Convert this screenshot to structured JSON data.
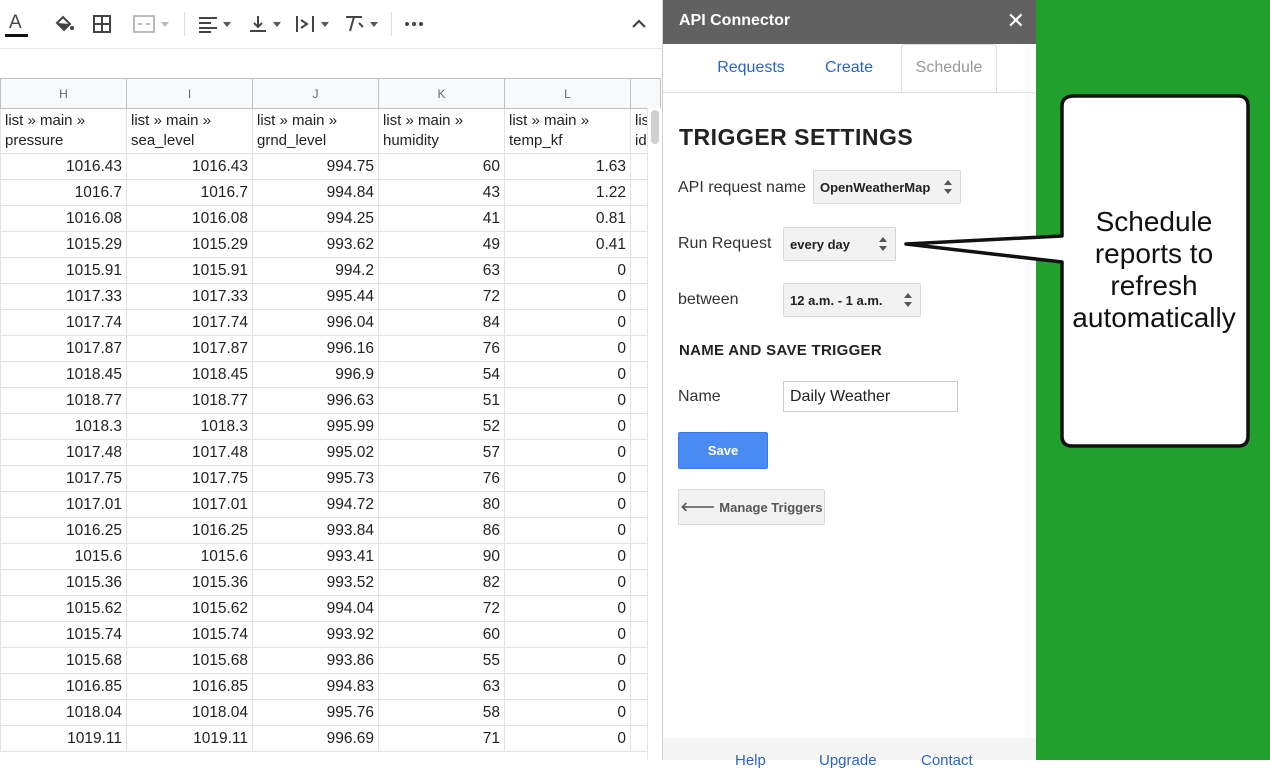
{
  "sheet": {
    "columns": [
      "H",
      "I",
      "J",
      "K",
      "L"
    ],
    "header_row": [
      "list » main » pressure",
      "list » main » sea_level",
      "list » main » grnd_level",
      "list » main » humidity",
      "list » main » temp_kf"
    ],
    "partial_col_header": "lis id",
    "rows": [
      [
        "1016.43",
        "1016.43",
        "994.75",
        "60",
        "1.63"
      ],
      [
        "1016.7",
        "1016.7",
        "994.84",
        "43",
        "1.22"
      ],
      [
        "1016.08",
        "1016.08",
        "994.25",
        "41",
        "0.81"
      ],
      [
        "1015.29",
        "1015.29",
        "993.62",
        "49",
        "0.41"
      ],
      [
        "1015.91",
        "1015.91",
        "994.2",
        "63",
        "0"
      ],
      [
        "1017.33",
        "1017.33",
        "995.44",
        "72",
        "0"
      ],
      [
        "1017.74",
        "1017.74",
        "996.04",
        "84",
        "0"
      ],
      [
        "1017.87",
        "1017.87",
        "996.16",
        "76",
        "0"
      ],
      [
        "1018.45",
        "1018.45",
        "996.9",
        "54",
        "0"
      ],
      [
        "1018.77",
        "1018.77",
        "996.63",
        "51",
        "0"
      ],
      [
        "1018.3",
        "1018.3",
        "995.99",
        "52",
        "0"
      ],
      [
        "1017.48",
        "1017.48",
        "995.02",
        "57",
        "0"
      ],
      [
        "1017.75",
        "1017.75",
        "995.73",
        "76",
        "0"
      ],
      [
        "1017.01",
        "1017.01",
        "994.72",
        "80",
        "0"
      ],
      [
        "1016.25",
        "1016.25",
        "993.84",
        "86",
        "0"
      ],
      [
        "1015.6",
        "1015.6",
        "993.41",
        "90",
        "0"
      ],
      [
        "1015.36",
        "1015.36",
        "993.52",
        "82",
        "0"
      ],
      [
        "1015.62",
        "1015.62",
        "994.04",
        "72",
        "0"
      ],
      [
        "1015.74",
        "1015.74",
        "993.92",
        "60",
        "0"
      ],
      [
        "1015.68",
        "1015.68",
        "993.86",
        "55",
        "0"
      ],
      [
        "1016.85",
        "1016.85",
        "994.83",
        "63",
        "0"
      ],
      [
        "1018.04",
        "1018.04",
        "995.76",
        "58",
        "0"
      ],
      [
        "1019.11",
        "1019.11",
        "996.69",
        "71",
        "0"
      ]
    ]
  },
  "panel": {
    "title": "API Connector",
    "close": "✕",
    "tabs": [
      "Requests",
      "Create",
      "Schedule"
    ],
    "heading": "TRIGGER SETTINGS",
    "api_request_label": "API request name",
    "api_request_value": "OpenWeatherMap",
    "run_request_label": "Run Request",
    "run_request_value": "every day",
    "between_label": "between",
    "between_value": "12 a.m. - 1 a.m.",
    "section_title": "NAME AND SAVE TRIGGER",
    "name_label": "Name",
    "name_value": "Daily Weather",
    "save_label": "Save",
    "manage_arrow": "🡐",
    "manage_label": "Manage Triggers",
    "footer_links": [
      "Help",
      "Upgrade",
      "Contact"
    ]
  },
  "callout": {
    "text": "Schedule reports to refresh automatically"
  },
  "colors": {
    "panel_header": "#616161",
    "accent_blue": "#4a8af4",
    "background_green": "#22a02e"
  }
}
